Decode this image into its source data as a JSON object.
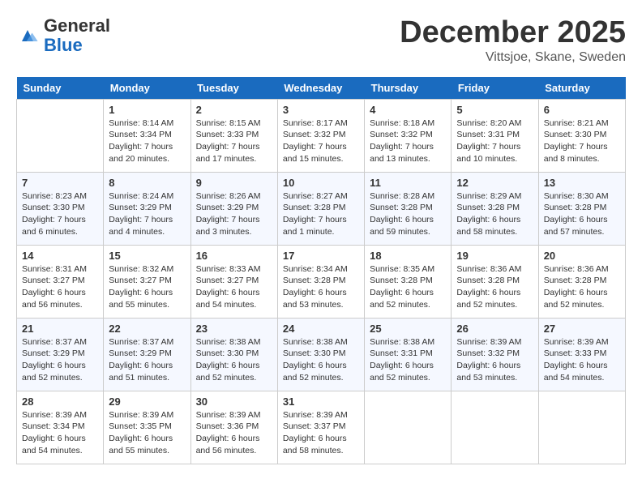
{
  "header": {
    "logo_general": "General",
    "logo_blue": "Blue",
    "month_title": "December 2025",
    "subtitle": "Vittsjoe, Skane, Sweden"
  },
  "weekdays": [
    "Sunday",
    "Monday",
    "Tuesday",
    "Wednesday",
    "Thursday",
    "Friday",
    "Saturday"
  ],
  "weeks": [
    [
      {
        "day": "",
        "info": ""
      },
      {
        "day": "1",
        "info": "Sunrise: 8:14 AM\nSunset: 3:34 PM\nDaylight: 7 hours\nand 20 minutes."
      },
      {
        "day": "2",
        "info": "Sunrise: 8:15 AM\nSunset: 3:33 PM\nDaylight: 7 hours\nand 17 minutes."
      },
      {
        "day": "3",
        "info": "Sunrise: 8:17 AM\nSunset: 3:32 PM\nDaylight: 7 hours\nand 15 minutes."
      },
      {
        "day": "4",
        "info": "Sunrise: 8:18 AM\nSunset: 3:32 PM\nDaylight: 7 hours\nand 13 minutes."
      },
      {
        "day": "5",
        "info": "Sunrise: 8:20 AM\nSunset: 3:31 PM\nDaylight: 7 hours\nand 10 minutes."
      },
      {
        "day": "6",
        "info": "Sunrise: 8:21 AM\nSunset: 3:30 PM\nDaylight: 7 hours\nand 8 minutes."
      }
    ],
    [
      {
        "day": "7",
        "info": "Sunrise: 8:23 AM\nSunset: 3:30 PM\nDaylight: 7 hours\nand 6 minutes."
      },
      {
        "day": "8",
        "info": "Sunrise: 8:24 AM\nSunset: 3:29 PM\nDaylight: 7 hours\nand 4 minutes."
      },
      {
        "day": "9",
        "info": "Sunrise: 8:26 AM\nSunset: 3:29 PM\nDaylight: 7 hours\nand 3 minutes."
      },
      {
        "day": "10",
        "info": "Sunrise: 8:27 AM\nSunset: 3:28 PM\nDaylight: 7 hours\nand 1 minute."
      },
      {
        "day": "11",
        "info": "Sunrise: 8:28 AM\nSunset: 3:28 PM\nDaylight: 6 hours\nand 59 minutes."
      },
      {
        "day": "12",
        "info": "Sunrise: 8:29 AM\nSunset: 3:28 PM\nDaylight: 6 hours\nand 58 minutes."
      },
      {
        "day": "13",
        "info": "Sunrise: 8:30 AM\nSunset: 3:28 PM\nDaylight: 6 hours\nand 57 minutes."
      }
    ],
    [
      {
        "day": "14",
        "info": "Sunrise: 8:31 AM\nSunset: 3:27 PM\nDaylight: 6 hours\nand 56 minutes."
      },
      {
        "day": "15",
        "info": "Sunrise: 8:32 AM\nSunset: 3:27 PM\nDaylight: 6 hours\nand 55 minutes."
      },
      {
        "day": "16",
        "info": "Sunrise: 8:33 AM\nSunset: 3:27 PM\nDaylight: 6 hours\nand 54 minutes."
      },
      {
        "day": "17",
        "info": "Sunrise: 8:34 AM\nSunset: 3:28 PM\nDaylight: 6 hours\nand 53 minutes."
      },
      {
        "day": "18",
        "info": "Sunrise: 8:35 AM\nSunset: 3:28 PM\nDaylight: 6 hours\nand 52 minutes."
      },
      {
        "day": "19",
        "info": "Sunrise: 8:36 AM\nSunset: 3:28 PM\nDaylight: 6 hours\nand 52 minutes."
      },
      {
        "day": "20",
        "info": "Sunrise: 8:36 AM\nSunset: 3:28 PM\nDaylight: 6 hours\nand 52 minutes."
      }
    ],
    [
      {
        "day": "21",
        "info": "Sunrise: 8:37 AM\nSunset: 3:29 PM\nDaylight: 6 hours\nand 52 minutes."
      },
      {
        "day": "22",
        "info": "Sunrise: 8:37 AM\nSunset: 3:29 PM\nDaylight: 6 hours\nand 51 minutes."
      },
      {
        "day": "23",
        "info": "Sunrise: 8:38 AM\nSunset: 3:30 PM\nDaylight: 6 hours\nand 52 minutes."
      },
      {
        "day": "24",
        "info": "Sunrise: 8:38 AM\nSunset: 3:30 PM\nDaylight: 6 hours\nand 52 minutes."
      },
      {
        "day": "25",
        "info": "Sunrise: 8:38 AM\nSunset: 3:31 PM\nDaylight: 6 hours\nand 52 minutes."
      },
      {
        "day": "26",
        "info": "Sunrise: 8:39 AM\nSunset: 3:32 PM\nDaylight: 6 hours\nand 53 minutes."
      },
      {
        "day": "27",
        "info": "Sunrise: 8:39 AM\nSunset: 3:33 PM\nDaylight: 6 hours\nand 54 minutes."
      }
    ],
    [
      {
        "day": "28",
        "info": "Sunrise: 8:39 AM\nSunset: 3:34 PM\nDaylight: 6 hours\nand 54 minutes."
      },
      {
        "day": "29",
        "info": "Sunrise: 8:39 AM\nSunset: 3:35 PM\nDaylight: 6 hours\nand 55 minutes."
      },
      {
        "day": "30",
        "info": "Sunrise: 8:39 AM\nSunset: 3:36 PM\nDaylight: 6 hours\nand 56 minutes."
      },
      {
        "day": "31",
        "info": "Sunrise: 8:39 AM\nSunset: 3:37 PM\nDaylight: 6 hours\nand 58 minutes."
      },
      {
        "day": "",
        "info": ""
      },
      {
        "day": "",
        "info": ""
      },
      {
        "day": "",
        "info": ""
      }
    ]
  ]
}
